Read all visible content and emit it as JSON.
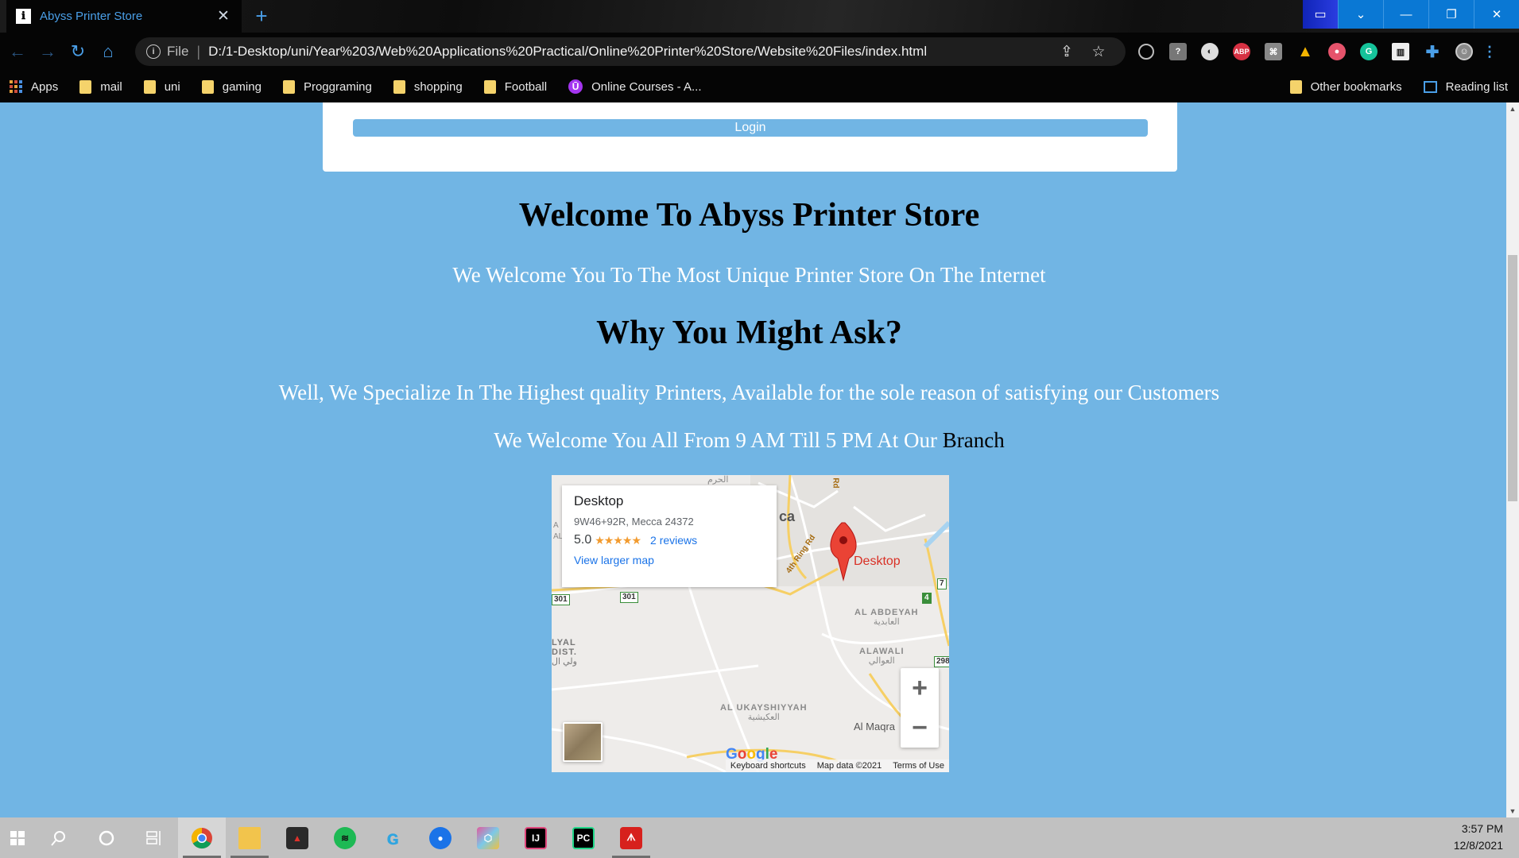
{
  "browser": {
    "tab_title": "Abyss Printer Store",
    "tab_favicon": "ℹ",
    "url_scheme": "File",
    "url": "D:/1-Desktop/uni/Year%203/Web%20Applications%20Practical/Online%20Printer%20Store/Website%20Files/index.html",
    "bookmarks": [
      "Apps",
      "mail",
      "uni",
      "gaming",
      "Proggraming",
      "shopping",
      "Football",
      "Online Courses - A..."
    ],
    "bookmarks_right": [
      "Other bookmarks",
      "Reading list"
    ],
    "extensions": [
      "media-icon",
      "help-icon",
      "grammar-badge-icon",
      "adblock-plus-icon",
      "pdf-icon",
      "google-drive-icon",
      "record-icon",
      "grammarly-icon",
      "reader-icon",
      "puzzle-icon",
      "profile-avatar",
      "menu-icon"
    ],
    "extension_badges": {
      "adblock": "ABP",
      "grammarly": "G"
    }
  },
  "page": {
    "login_button": "Login",
    "welcome_heading": "Welcome To Abyss Printer Store",
    "welcome_text": "We Welcome You To The Most Unique Printer Store On The Internet",
    "why_heading": "Why You Might Ask?",
    "why_text": "Well, We Specialize In The Highest quality Printers, Available for the sole reason of satisfying our Customers",
    "hours_text": "We Welcome You All From 9 AM Till 5 PM At Our ",
    "hours_link": "Branch",
    "colors": {
      "page_bg": "#71b5e4",
      "heading": "#000000",
      "text": "#ffffff"
    }
  },
  "map": {
    "place_name": "Desktop",
    "address": "9W46+92R, Mecca 24372",
    "rating": "5.0",
    "stars": "★★★★★",
    "reviews": "2 reviews",
    "larger_map": "View larger map",
    "pin_label": "Desktop",
    "road_label": "4th Ring Rd",
    "road_label_rd": "Rd",
    "city_fragment": "ca",
    "areas": {
      "abdeyah": "AL ABDEYAH",
      "abdeyah_ar": "العابدية",
      "awali": "ALAWALI",
      "awali_ar": "العوالي",
      "ukayshiyyah": "AL UKAYSHIYYAH",
      "ukayshiyyah_ar": "العكيشية",
      "lyal": "LYAL",
      "dist": "DIST.",
      "lyal_ar": "ولي ال",
      "maqra": "Al Maqra",
      "haram_ar": "الحرم",
      "edge_a": "A",
      "edge_al": "AL"
    },
    "road_signs": [
      "301",
      "301",
      "7",
      "4",
      "298"
    ],
    "footer": [
      "Keyboard shortcuts",
      "Map data ©2021",
      "Terms of Use"
    ],
    "google_logo": [
      "G",
      "o",
      "o",
      "g",
      "l",
      "e"
    ]
  },
  "taskbar": {
    "apps": [
      "windows-start-icon",
      "search-icon",
      "cortana-icon",
      "task-view-icon",
      "chrome-icon",
      "file-explorer-icon",
      "red-app-icon",
      "spotify-icon",
      "logitech-icon",
      "maps-pin-icon",
      "cube-app-icon",
      "intellij-icon",
      "pycharm-icon",
      "acrobat-icon"
    ],
    "intellij_label": "IJ",
    "pycharm_label": "PC",
    "time": "3:57 PM",
    "date": "12/8/2021"
  }
}
